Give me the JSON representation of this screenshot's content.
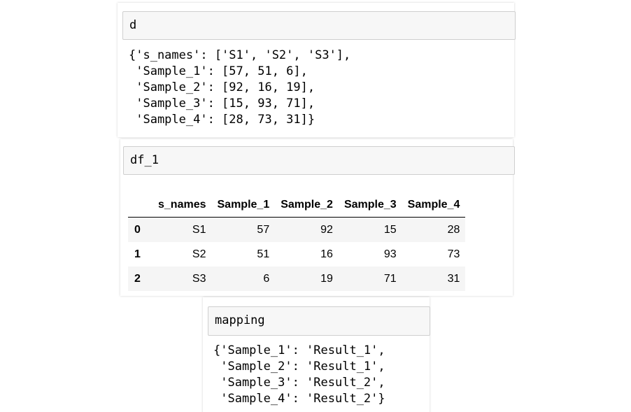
{
  "cells": [
    {
      "input": "d",
      "output_lines": [
        "{'s_names': ['S1', 'S2', 'S3'],",
        " 'Sample_1': [57, 51, 6],",
        " 'Sample_2': [92, 16, 19],",
        " 'Sample_3': [15, 93, 71],",
        " 'Sample_4': [28, 73, 31]}"
      ]
    },
    {
      "input": "df_1",
      "table": {
        "columns": [
          "",
          "s_names",
          "Sample_1",
          "Sample_2",
          "Sample_3",
          "Sample_4"
        ],
        "rows": [
          [
            "0",
            "S1",
            "57",
            "92",
            "15",
            "28"
          ],
          [
            "1",
            "S2",
            "51",
            "16",
            "93",
            "73"
          ],
          [
            "2",
            "S3",
            "6",
            "19",
            "71",
            "31"
          ]
        ]
      }
    },
    {
      "input": "mapping",
      "output_lines": [
        "{'Sample_1': 'Result_1',",
        " 'Sample_2': 'Result_1',",
        " 'Sample_3': 'Result_2',",
        " 'Sample_4': 'Result_2'}"
      ]
    }
  ]
}
